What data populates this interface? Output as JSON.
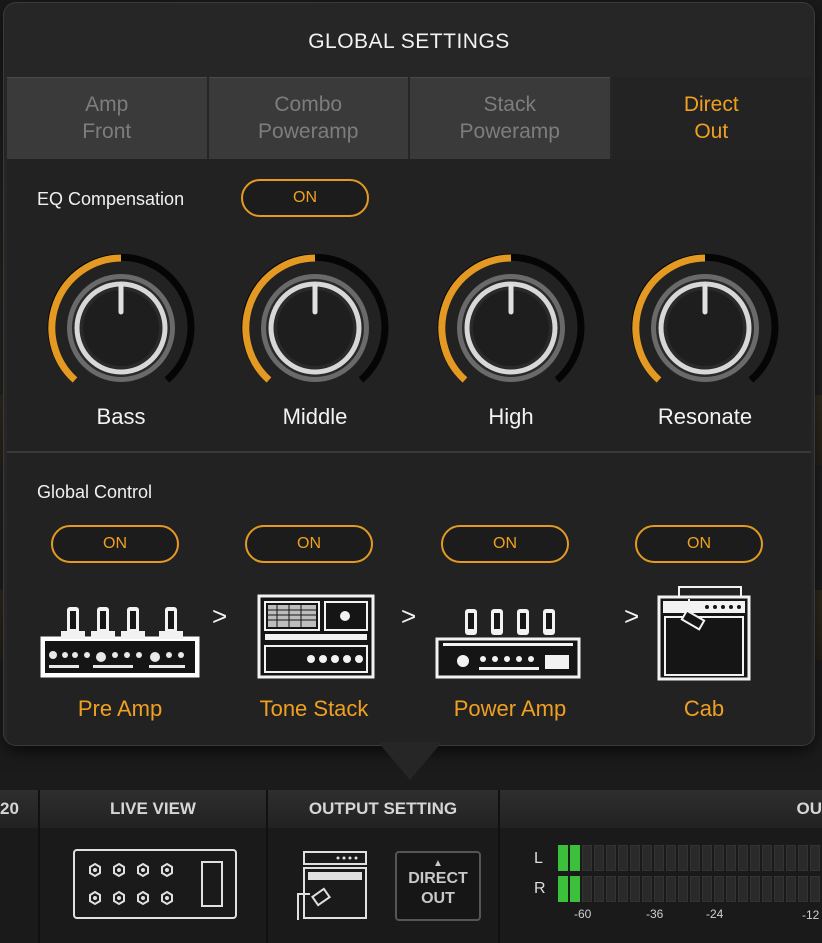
{
  "dialog": {
    "title": "GLOBAL SETTINGS",
    "tabs": [
      {
        "line1": "Amp",
        "line2": "Front",
        "active": false
      },
      {
        "line1": "Combo",
        "line2": "Poweramp",
        "active": false
      },
      {
        "line1": "Stack",
        "line2": "Poweramp",
        "active": false
      },
      {
        "line1": "Direct",
        "line2": "Out",
        "active": true
      }
    ],
    "eq_compensation": {
      "label": "EQ Compensation",
      "toggle": "ON"
    },
    "knobs": [
      {
        "label": "Bass",
        "value": 0.5
      },
      {
        "label": "Middle",
        "value": 0.5
      },
      {
        "label": "High",
        "value": 0.5
      },
      {
        "label": "Resonate",
        "value": 0.5
      }
    ],
    "global_control": {
      "label": "Global Control",
      "stages": [
        {
          "toggle": "ON",
          "label": "Pre Amp",
          "icon": "preamp-icon"
        },
        {
          "toggle": "ON",
          "label": "Tone Stack",
          "icon": "tone-stack-icon"
        },
        {
          "toggle": "ON",
          "label": "Power Amp",
          "icon": "power-amp-icon"
        },
        {
          "toggle": "ON",
          "label": "Cab",
          "icon": "cab-icon"
        }
      ],
      "separator": ">"
    }
  },
  "bottom_bar": {
    "left_partial": "20",
    "live_view": "LIVE VIEW",
    "output_setting": "OUTPUT SETTING",
    "right_partial": "OU",
    "direct_out_line1": "DIRECT",
    "direct_out_line2": "OUT",
    "meter": {
      "channels": [
        "L",
        "R"
      ],
      "scale": [
        "-60",
        "-36",
        "-24",
        "-12"
      ]
    }
  },
  "colors": {
    "accent": "#f0a020",
    "panel": "#262626",
    "text": "#f2f2f2"
  }
}
